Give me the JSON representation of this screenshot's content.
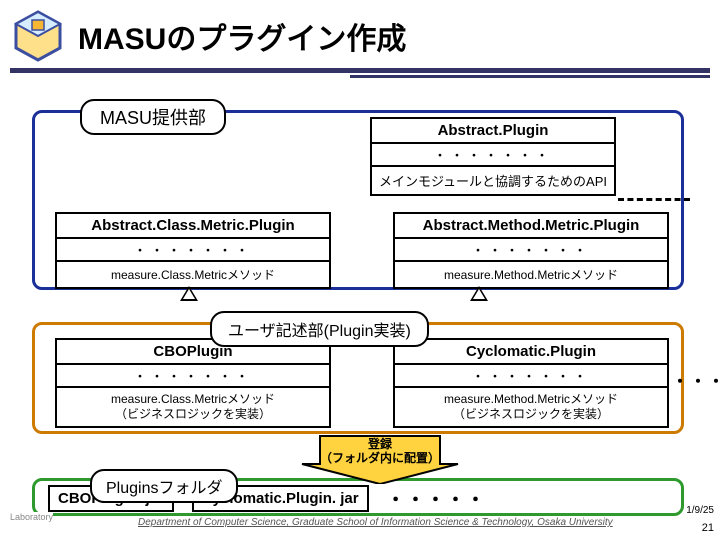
{
  "title": "MASUのプラグイン作成",
  "masu_label": "MASU提供部",
  "abstract_plugin": {
    "name": "Abstract.Plugin",
    "dots": "・・・・・・・",
    "api": "メインモジュールと協調するためのAPI"
  },
  "abstract_class": {
    "name": "Abstract.Class.Metric.Plugin",
    "dots": "・・・・・・・",
    "method": "measure.Class.Metricメソッド"
  },
  "abstract_method": {
    "name": "Abstract.Method.Metric.Plugin",
    "dots": "・・・・・・・",
    "method": "measure.Method.Metricメソッド"
  },
  "user_label": "ユーザ記述部(Plugin実装)",
  "cbo": {
    "name": "CBOPlugin",
    "dots": "・・・・・・・",
    "method": "measure.Class.Metricメソッド\n（ビジネスロジックを実装）"
  },
  "cyclo": {
    "name": "Cyclomatic.Plugin",
    "dots": "・・・・・・・",
    "method": "measure.Method.Metricメソッド\n（ビジネスロジックを実装）"
  },
  "row2_dots": "・・・・・",
  "arrow": {
    "l1": "登録",
    "l2": "（フォルダ内に配置）"
  },
  "folder": "Pluginsフォルダ",
  "jars": [
    "CBOPlugin. jar",
    "Cyclomatic.Plugin. jar"
  ],
  "jar_dots": "・・・・・",
  "footer": "Department of Computer Science, Graduate School of Information Science & Technology, Osaka University",
  "date": "1/9/25",
  "page": "21",
  "lab": "Laboratory"
}
